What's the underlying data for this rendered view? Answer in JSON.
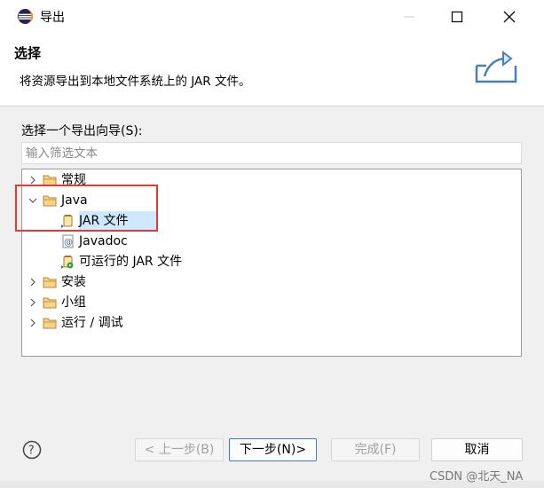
{
  "window": {
    "title": "导出"
  },
  "header": {
    "title": "选择",
    "description": "将资源导出到本地文件系统上的 JAR 文件。"
  },
  "wizard": {
    "label": "选择一个导出向导(S):",
    "filter_placeholder": "输入筛选文本",
    "tree": {
      "general": "常规",
      "java": "Java",
      "jar_file": "JAR 文件",
      "javadoc": "Javadoc",
      "runnable_jar": "可运行的 JAR 文件",
      "install": "安装",
      "team": "小组",
      "run_debug": "运行 / 调试"
    }
  },
  "buttons": {
    "back": "< 上一步(B)",
    "next": "下一步(N)>",
    "finish": "完成(F)",
    "cancel": "取消"
  },
  "watermark": "CSDN @北天_NA",
  "colors": {
    "highlight": "#e53935",
    "selection": "#cde8ff",
    "folder": "#e8b04a"
  }
}
